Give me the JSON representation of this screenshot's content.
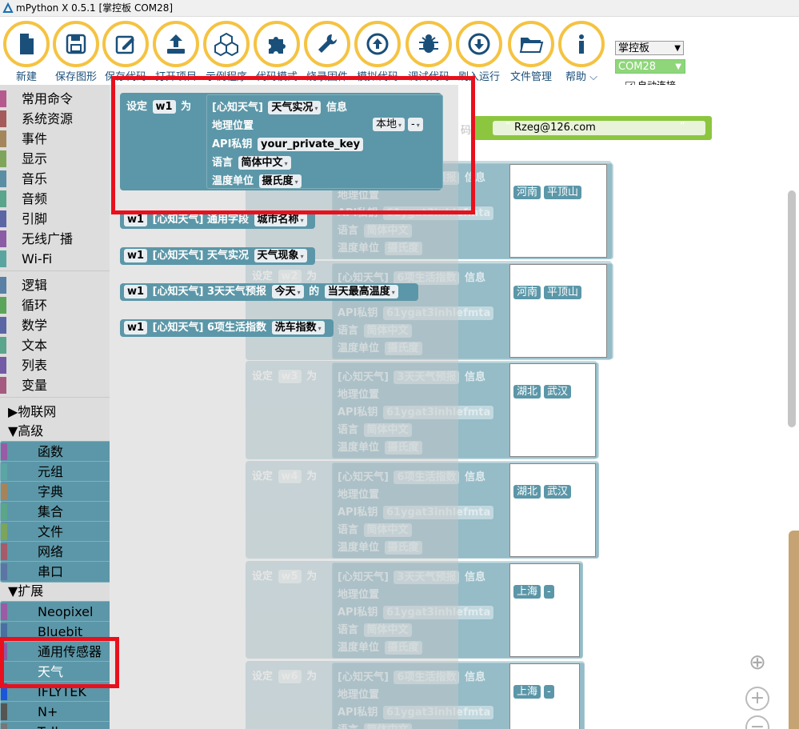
{
  "app": {
    "title": "mPython X 0.5.1 [掌控板 COM28]"
  },
  "toolbar": {
    "buttons": [
      {
        "label": "新建",
        "icon": "new-file-icon"
      },
      {
        "label": "保存图形",
        "icon": "save-icon"
      },
      {
        "label": "保存代码",
        "icon": "edit-icon"
      },
      {
        "label": "打开项目",
        "icon": "upload-icon"
      },
      {
        "label": "示例程序",
        "icon": "cubes-icon"
      },
      {
        "label": "代码模式",
        "icon": "puzzle-icon"
      },
      {
        "label": "烧录固件",
        "icon": "wrench-icon"
      },
      {
        "label": "模拟代码",
        "icon": "arrow-up-circle-icon"
      },
      {
        "label": "调试代码",
        "icon": "bug-icon"
      },
      {
        "label": "刷入运行",
        "icon": "arrow-down-circle-icon"
      },
      {
        "label": "文件管理",
        "icon": "folder-icon"
      },
      {
        "label": "帮助 ⌵",
        "icon": "info-icon"
      }
    ],
    "board_select": "掌控板",
    "port_select": "COM28",
    "auto_connect": "自动连接"
  },
  "sidebar": {
    "categories": [
      {
        "label": "常用命令",
        "color": "#b55a8e"
      },
      {
        "label": "系统资源",
        "color": "#a55b5b"
      },
      {
        "label": "事件",
        "color": "#a5865b"
      },
      {
        "label": "显示",
        "color": "#7fa55b"
      },
      {
        "label": "音乐",
        "color": "#5b8ea5"
      },
      {
        "label": "音频",
        "color": "#5ba58c"
      },
      {
        "label": "引脚",
        "color": "#5b67a5"
      },
      {
        "label": "无线广播",
        "color": "#8c5ba5"
      },
      {
        "label": "Wi-Fi",
        "color": "#5ba5a0"
      }
    ],
    "logic": [
      {
        "label": "逻辑",
        "color": "#5b80a5"
      },
      {
        "label": "循环",
        "color": "#5ba55b"
      },
      {
        "label": "数学",
        "color": "#5b67a5"
      },
      {
        "label": "文本",
        "color": "#5ba58c"
      },
      {
        "label": "列表",
        "color": "#745ba5"
      },
      {
        "label": "变量",
        "color": "#a55b80"
      }
    ],
    "iot": "▶物联网",
    "advanced": "▼高级",
    "advanced_items": [
      {
        "label": "函数",
        "color": "#995ba5"
      },
      {
        "label": "元组",
        "color": "#5ba5a5"
      },
      {
        "label": "字典",
        "color": "#a5845b"
      },
      {
        "label": "集合",
        "color": "#5ba58a"
      },
      {
        "label": "文件",
        "color": "#7aa55b"
      },
      {
        "label": "网络",
        "color": "#a55b6a"
      },
      {
        "label": "串口",
        "color": "#5b75a5"
      }
    ],
    "extensions": "▼扩展",
    "extension_items": [
      {
        "label": "Neopixel",
        "color": "#9c5ba5"
      },
      {
        "label": "Bluebit",
        "color": "#4a6fa0"
      },
      {
        "label": "通用传感器",
        "color": "#8c5ba5"
      },
      {
        "label": "天气",
        "color": "#5b97a8"
      },
      {
        "label": "IFLYTEK",
        "color": "#1a57d8"
      },
      {
        "label": "N+",
        "color": "#555555"
      },
      {
        "label": "Tello",
        "color": "#777777"
      }
    ]
  },
  "workspace": {
    "main_block": {
      "set": "设定",
      "var": "w1",
      "as": "为",
      "title": "[心知天气]",
      "mode": "天气实况",
      "info": "信息",
      "location_label": "地理位置",
      "location_value": "本地",
      "location_sub": "-",
      "api_label": "API私钥",
      "api_value": "your_private_key",
      "lang_label": "语言",
      "lang_value": "简体中文",
      "unit_label": "温度单位",
      "unit_value": "摄氏度"
    },
    "email_block": {
      "text": "Rzeg@126.com",
      "partial": "码"
    },
    "field_blocks": [
      {
        "var": "w1",
        "title": "[心知天气] 通用字段",
        "field": "城市名称"
      },
      {
        "var": "w1",
        "title": "[心知天气] 天气实况",
        "field": "天气现象"
      },
      {
        "var": "w1",
        "title": "[心知天气] 3天天气预报",
        "field": "今天",
        "of": "的",
        "field2": "当天最高温度"
      },
      {
        "var": "w1",
        "title": "[心知天气] 6项生活指数",
        "field": "洗车指数"
      }
    ],
    "ghost_blocks": [
      {
        "var": "w2",
        "mode": "3天天气预报",
        "province": "河南",
        "city": "平顶山"
      },
      {
        "var": "w2",
        "mode": "6项生活指数",
        "province": "河南",
        "city": "平顶山"
      },
      {
        "var": "w3",
        "mode": "3天天气预报",
        "province": "湖北",
        "city": "武汉"
      },
      {
        "var": "w4",
        "mode": "6项生活指数",
        "province": "湖北",
        "city": "武汉"
      },
      {
        "var": "w5",
        "mode": "3天天气预报",
        "province": "上海",
        "city": "-"
      },
      {
        "var": "w6",
        "mode": "6项生活指数",
        "province": "上海",
        "city": "-"
      }
    ],
    "ghost_labels": {
      "set": "设定",
      "as": "为",
      "title": "[心知天气]",
      "info": "信息",
      "location": "地理位置",
      "api": "API私钥",
      "api_value": "61ygat3inhlefmta",
      "lang": "语言",
      "lang_value": "简体中文",
      "unit": "温度单位",
      "unit_value": "摄氏度"
    }
  },
  "colors": {
    "block": "#5b97a8",
    "highlight": "#e8101c",
    "toolbar_ring": "#f5c342",
    "text_block": "#8cc63f"
  }
}
